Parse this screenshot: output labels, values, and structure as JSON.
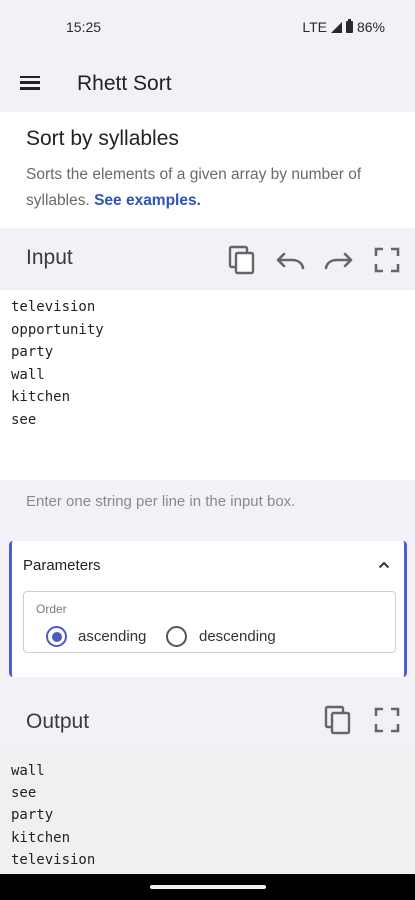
{
  "status": {
    "time": "15:25",
    "network": "LTE",
    "battery": "86%"
  },
  "app": {
    "title": "Rhett Sort"
  },
  "description": {
    "title": "Sort by syllables",
    "text": "Sorts the elements of a given array by number of syllables. ",
    "link": "See examples."
  },
  "input": {
    "label": "Input",
    "lines": [
      "television",
      "opportunity",
      "party",
      "wall",
      "kitchen",
      "see"
    ],
    "hint": "Enter one string per line in the input box."
  },
  "parameters": {
    "title": "Parameters",
    "order_label": "Order",
    "options": [
      "ascending",
      "descending"
    ],
    "selected": "ascending"
  },
  "output": {
    "label": "Output",
    "lines": [
      "wall",
      "see",
      "party",
      "kitchen",
      "television"
    ]
  },
  "colors": {
    "accent": "#4a5bc6",
    "link": "#2f52b5",
    "panel_border": "#5160c4"
  },
  "icons": [
    "menu-icon",
    "copy-icon",
    "undo-icon",
    "redo-icon",
    "fullscreen-icon",
    "chevron-up-icon"
  ]
}
